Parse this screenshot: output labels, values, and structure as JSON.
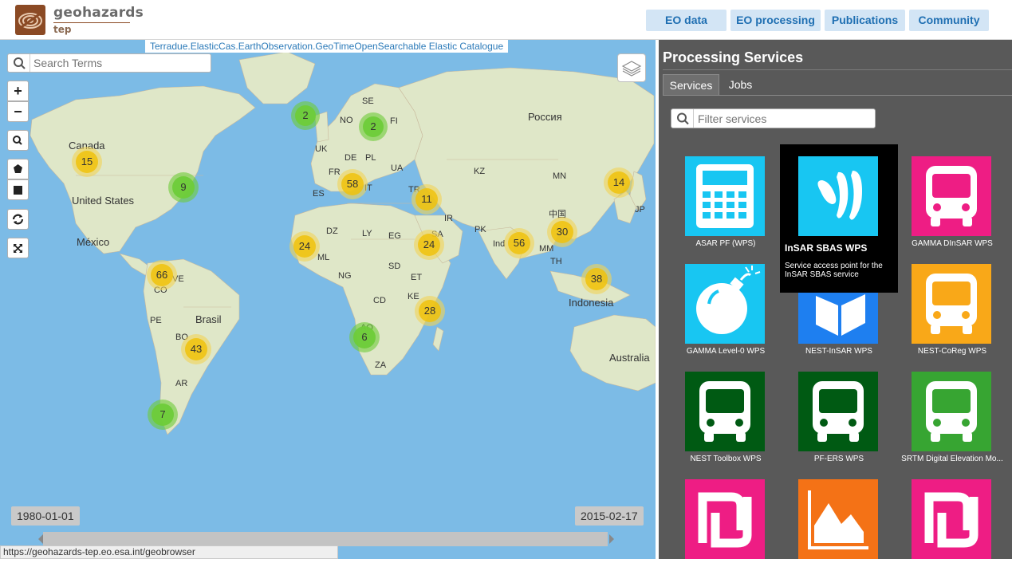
{
  "header": {
    "logo_title": "geohazards",
    "logo_sub": "tep",
    "nav": [
      "EO data",
      "EO processing",
      "Publications",
      "Community"
    ]
  },
  "map": {
    "catalogue_label": "Terradue.ElasticCas.EarthObservation.GeoTimeOpenSearchable Elastic Catalogue",
    "search_placeholder": "Search Terms",
    "controls": {
      "zoom_in": "+",
      "zoom_out": "−"
    },
    "clusters": [
      {
        "count": "2",
        "color": "green"
      },
      {
        "count": "2",
        "color": "green"
      },
      {
        "count": "15",
        "color": "yellow"
      },
      {
        "count": "9",
        "color": "green"
      },
      {
        "count": "58",
        "color": "yellow"
      },
      {
        "count": "11",
        "color": "yellow"
      },
      {
        "count": "14",
        "color": "yellow"
      },
      {
        "count": "24",
        "color": "yellow"
      },
      {
        "count": "24",
        "color": "yellow"
      },
      {
        "count": "56",
        "color": "yellow"
      },
      {
        "count": "30",
        "color": "yellow"
      },
      {
        "count": "66",
        "color": "yellow"
      },
      {
        "count": "38",
        "color": "yellow"
      },
      {
        "count": "28",
        "color": "yellow"
      },
      {
        "count": "6",
        "color": "green"
      },
      {
        "count": "43",
        "color": "yellow"
      },
      {
        "count": "7",
        "color": "green"
      }
    ],
    "labels": [
      "Canada",
      "United States",
      "México",
      "Brasil",
      "Россия",
      "Indonesia",
      "Australia",
      "SE",
      "NO",
      "UK",
      "FI",
      "DE",
      "PL",
      "UA",
      "FR",
      "ES",
      "IT",
      "TR",
      "KZ",
      "MN",
      "IR",
      "PK",
      "中国",
      "JP",
      "DZ",
      "LY",
      "EG",
      "SA",
      "ML",
      "NG",
      "SD",
      "ET",
      "CD",
      "KE",
      "AO",
      "ZA",
      "PE",
      "BO",
      "AR",
      "VE",
      "CO",
      "MM",
      "TH",
      "Ind"
    ],
    "date_start": "1980-01-01",
    "date_end": "2015-02-17"
  },
  "status_url": "https://geohazards-tep.eo.esa.int/geobrowser",
  "panel": {
    "title": "Processing Services",
    "tabs": [
      "Services",
      "Jobs"
    ],
    "filter_placeholder": "Filter services",
    "services": [
      {
        "name": "ASAR PF (WPS)",
        "color": "#18c6f2",
        "icon": "calculator-icon"
      },
      {
        "name": "InSAR SBAS WPS",
        "color": "#18c6f2",
        "icon": "wave-icon"
      },
      {
        "name": "GAMMA DInSAR WPS",
        "color": "#ee1d84",
        "icon": "bus-icon"
      },
      {
        "name": "GAMMA Level-0 WPS",
        "color": "#18c6f2",
        "icon": "bomb-icon"
      },
      {
        "name": "NEST-InSAR WPS",
        "color": "#1e7ff0",
        "icon": "cube-icon"
      },
      {
        "name": "NEST-CoReg WPS",
        "color": "#f9a818",
        "icon": "bus-icon"
      },
      {
        "name": "NEST Toolbox WPS",
        "color": "#005a13",
        "icon": "bus-icon"
      },
      {
        "name": "PF-ERS WPS",
        "color": "#005a13",
        "icon": "bus-icon"
      },
      {
        "name": "SRTM Digital Elevation Mo...",
        "color": "#37a532",
        "icon": "bus-icon"
      },
      {
        "name": "",
        "color": "#ee1d84",
        "icon": "sheqel-icon"
      },
      {
        "name": "",
        "color": "#f47216",
        "icon": "area-chart-icon"
      },
      {
        "name": "",
        "color": "#ee1d84",
        "icon": "sheqel-icon"
      }
    ],
    "tooltip": {
      "title": "InSAR SBAS WPS",
      "description": "Service access point for the InSAR SBAS service"
    }
  }
}
